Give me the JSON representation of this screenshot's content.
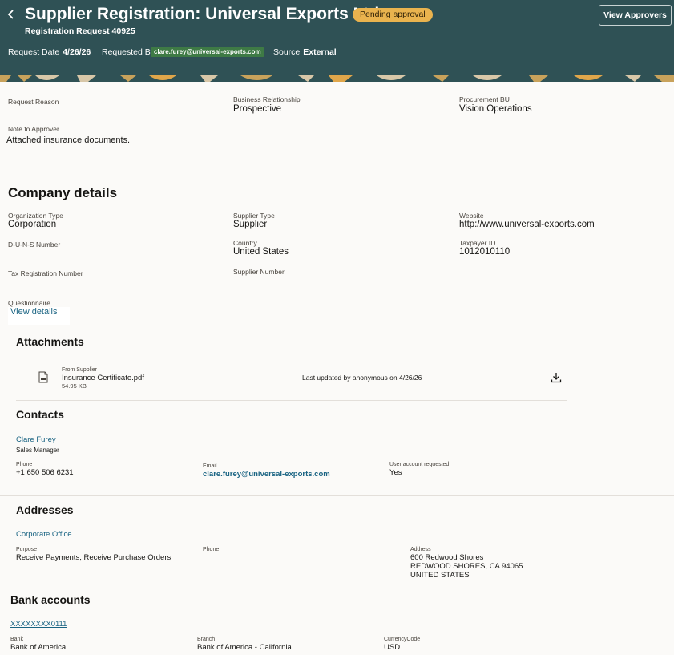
{
  "header": {
    "title": "Supplier Registration: Universal Exports Ltd.",
    "status_badge": "Pending approval",
    "subtitle": "Registration Request 40925",
    "request_date_label": "Request Date",
    "request_date": "4/26/26",
    "requested_by_label": "Requested By",
    "requested_by": "clare.furey@universal-exports.com",
    "source_label": "Source",
    "source": "External",
    "view_approvers_label": "View Approvers",
    "back_icon": "chevron-left-icon"
  },
  "request": {
    "reason_label": "Request Reason",
    "business_relationship_label": "Business Relationship",
    "business_relationship": "Prospective",
    "procurement_bu_label": "Procurement BU",
    "procurement_bu": "Vision Operations",
    "note_label": "Note to Approver",
    "note": "Attached insurance documents."
  },
  "company": {
    "heading": "Company details",
    "org_type_label": "Organization Type",
    "org_type": "Corporation",
    "supplier_type_label": "Supplier Type",
    "supplier_type": "Supplier",
    "website_label": "Website",
    "website": "http://www.universal-exports.com",
    "duns_label": "D-U-N-S Number",
    "country_label": "Country",
    "country": "United States",
    "taxpayer_label": "Taxpayer ID",
    "taxpayer": "1012010110",
    "tax_reg_label": "Tax Registration Number",
    "supplier_number_label": "Supplier Number",
    "questionnaire_label": "Questionnaire",
    "questionnaire_link": "View details"
  },
  "attachments": {
    "heading": "Attachments",
    "items": [
      {
        "source": "From Supplier",
        "name": "Insurance Certificate.pdf",
        "size": "54.95 KB",
        "updated": "Last updated by anonymous on 4/26/26",
        "file_icon": "document-icon",
        "download_icon": "download-icon"
      }
    ]
  },
  "contacts": {
    "heading": "Contacts",
    "name": "Clare Furey",
    "title": "Sales Manager",
    "phone_label": "Phone",
    "phone": "+1 650 506 6231",
    "email_label": "Email",
    "email": "clare.furey@universal-exports.com",
    "user_account_label": "User account requested",
    "user_account": "Yes"
  },
  "addresses": {
    "heading": "Addresses",
    "name": "Corporate Office",
    "purpose_label": "Purpose",
    "purpose": "Receive Payments, Receive Purchase Orders",
    "phone_label": "Phone",
    "address_label": "Address",
    "address_line1": "600 Redwood Shores",
    "address_line2": "REDWOOD SHORES, CA 94065",
    "address_line3": "UNITED STATES"
  },
  "bank": {
    "heading": "Bank accounts",
    "account": "XXXXXXXX0111",
    "bank_label": "Bank",
    "bank": "Bank of America",
    "branch_label": "Branch",
    "branch": "Bank of America - California",
    "currency_label": "CurrencyCode",
    "currency": "USD"
  },
  "colors": {
    "header_bg": "#2f5155",
    "badge_bg": "#eab34e",
    "link": "#1a6483",
    "email_chip": "#3e7a45"
  }
}
